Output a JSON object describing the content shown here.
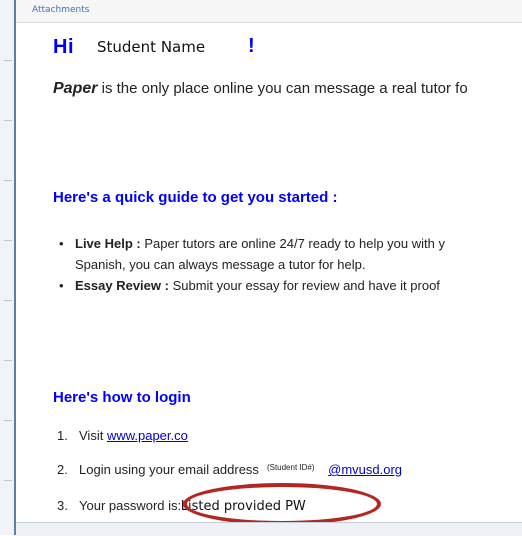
{
  "attachments_label": "Attachments",
  "greeting": {
    "hi": "Hi",
    "name": "Student Name",
    "exclaim": "!"
  },
  "intro": {
    "brand": "Paper",
    "text": " is the only place online you can message a real tutor fo"
  },
  "guide": {
    "heading": "Here's a quick guide to get you started :",
    "items": [
      {
        "term": "Live Help :",
        "text": " Paper tutors are online 24/7 ready to help you with y",
        "continuation": "Spanish, you can always message a tutor for help."
      },
      {
        "term": "Essay Review :",
        "text": " Submit your essay for review and have it proof"
      }
    ]
  },
  "login": {
    "heading": "Here's how to login",
    "steps": [
      {
        "num": "1.",
        "text": "Visit ",
        "link": "www.paper.co"
      },
      {
        "num": "2.",
        "text": "Login using your email address",
        "small": "(Student ID#)",
        "link": "@mvusd.org"
      },
      {
        "num": "3.",
        "text": "Your password is:",
        "handwritten": "Listed provided PW"
      }
    ]
  },
  "colors": {
    "heading_blue": "#0000ff",
    "link_blue": "#0000cc",
    "oval_red": "#b32622"
  }
}
